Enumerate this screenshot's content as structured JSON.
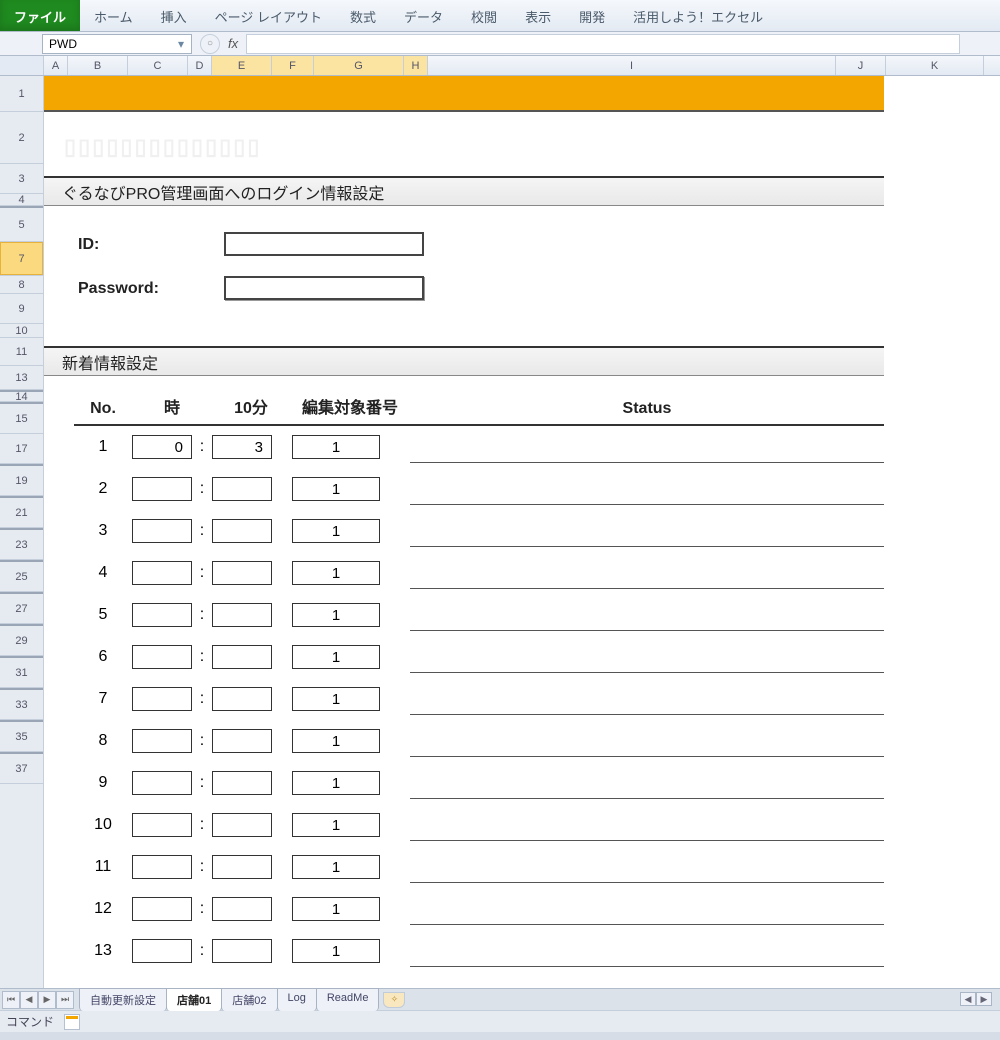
{
  "ribbon": {
    "tabs": [
      "ファイル",
      "ホーム",
      "挿入",
      "ページ レイアウト",
      "数式",
      "データ",
      "校閲",
      "表示",
      "開発",
      "活用しよう！エクセル"
    ]
  },
  "formula_bar": {
    "name_box": "PWD",
    "fx_label": "fx",
    "formula": ""
  },
  "columns": [
    "A",
    "B",
    "C",
    "D",
    "E",
    "F",
    "G",
    "H",
    "I",
    "J",
    "K"
  ],
  "row_headers": {
    "rows": [
      "1",
      "2",
      "3",
      "4",
      "5",
      "7",
      "8",
      "9",
      "10",
      "11",
      "13",
      "14",
      "15",
      "17",
      "19",
      "21",
      "23",
      "25",
      "27",
      "29",
      "31",
      "33",
      "35",
      "37"
    ],
    "heights": [
      36,
      52,
      30,
      12,
      34,
      34,
      18,
      30,
      14,
      28,
      24,
      10,
      30,
      30,
      30,
      30,
      30,
      30,
      30,
      30,
      30,
      30,
      30,
      30
    ],
    "hidden_after": {
      "4": true,
      "13": true,
      "14": true,
      "17": true,
      "19": true,
      "21": true,
      "23": true,
      "25": true,
      "27": true,
      "29": true,
      "31": true,
      "33": true,
      "35": true
    }
  },
  "selected_row": "7",
  "selected_cols": [
    "E",
    "F",
    "G",
    "H"
  ],
  "sheet_content": {
    "section_login": "ぐるなびPRO管理画面へのログイン情報設定",
    "id_label": "ID:",
    "pw_label": "Password:",
    "id_value": "",
    "pw_value": "",
    "section_news": "新着情報設定",
    "col_no": "No.",
    "col_hour": "時",
    "col_min": "10分",
    "col_edit": "編集対象番号",
    "col_status": "Status",
    "rows": [
      {
        "no": "1",
        "hour": "0",
        "min": "3",
        "edit": "1",
        "status": ""
      },
      {
        "no": "2",
        "hour": "",
        "min": "",
        "edit": "1",
        "status": ""
      },
      {
        "no": "3",
        "hour": "",
        "min": "",
        "edit": "1",
        "status": ""
      },
      {
        "no": "4",
        "hour": "",
        "min": "",
        "edit": "1",
        "status": ""
      },
      {
        "no": "5",
        "hour": "",
        "min": "",
        "edit": "1",
        "status": ""
      },
      {
        "no": "6",
        "hour": "",
        "min": "",
        "edit": "1",
        "status": ""
      },
      {
        "no": "7",
        "hour": "",
        "min": "",
        "edit": "1",
        "status": ""
      },
      {
        "no": "8",
        "hour": "",
        "min": "",
        "edit": "1",
        "status": ""
      },
      {
        "no": "9",
        "hour": "",
        "min": "",
        "edit": "1",
        "status": ""
      },
      {
        "no": "10",
        "hour": "",
        "min": "",
        "edit": "1",
        "status": ""
      },
      {
        "no": "11",
        "hour": "",
        "min": "",
        "edit": "1",
        "status": ""
      },
      {
        "no": "12",
        "hour": "",
        "min": "",
        "edit": "1",
        "status": ""
      },
      {
        "no": "13",
        "hour": "",
        "min": "",
        "edit": "1",
        "status": ""
      }
    ]
  },
  "sheet_tabs": [
    "自動更新設定",
    "店舗01",
    "店舗02",
    "Log",
    "ReadMe"
  ],
  "active_sheet": "店舗01",
  "status_bar": {
    "mode": "コマンド"
  }
}
